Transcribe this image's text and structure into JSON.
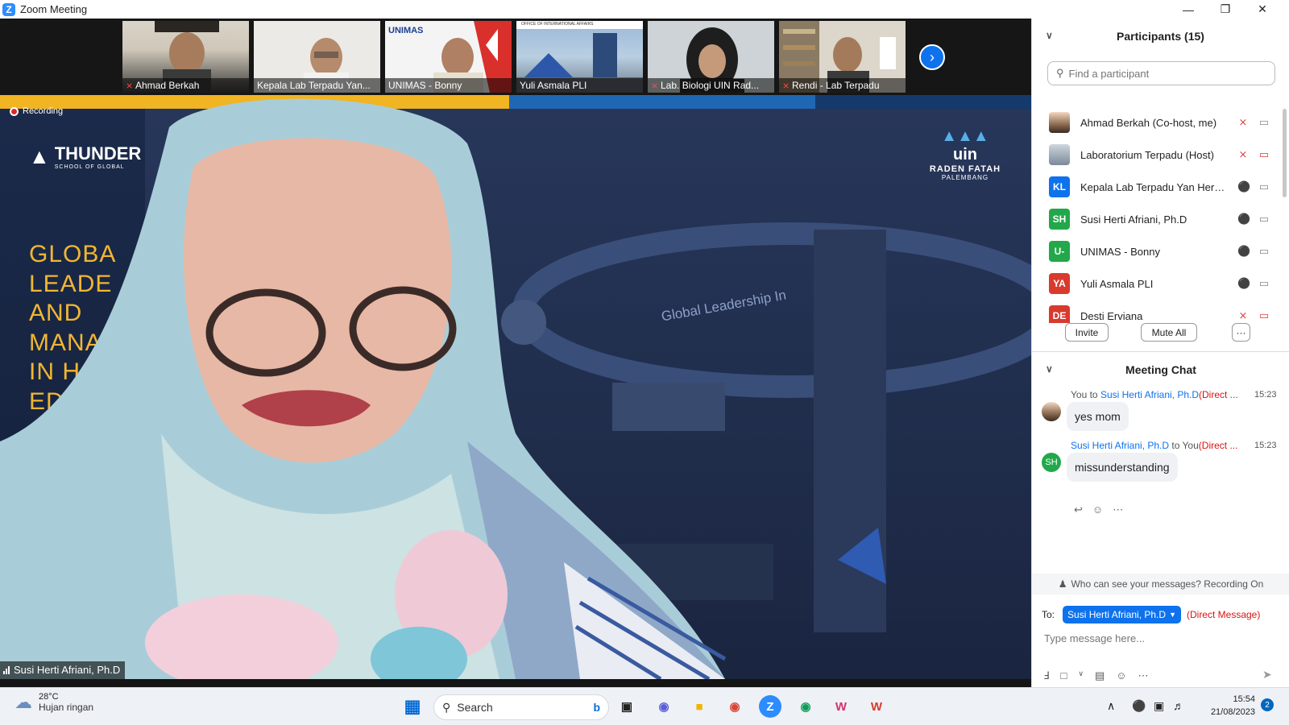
{
  "window": {
    "title": "Zoom Meeting"
  },
  "gallery": {
    "tiles": [
      {
        "name": "Ahmad Berkah",
        "muted": true
      },
      {
        "name": "Kepala Lab Terpadu Yan...",
        "muted": false
      },
      {
        "name": "UNIMAS - Bonny",
        "muted": false
      },
      {
        "name": "Yuli Asmala PLI",
        "muted": false
      },
      {
        "name": "Lab. Biologi UIN Rad...",
        "muted": true
      },
      {
        "name": "Rendi - Lab Terpadu",
        "muted": true
      }
    ],
    "tile_overlays": {
      "unimas_logo": "UNIMAS",
      "building_sign": "OFFICE OF INTERNATIONAL AFFAIRS"
    }
  },
  "speaker": {
    "recording_label": "Recording",
    "name": "Susi Herti Afriani, Ph.D",
    "slide_lines": [
      "GLOBA",
      "LEADE",
      "AND",
      "MANA",
      "IN H",
      "EDU"
    ],
    "slide_brand": "THUNDER",
    "slide_brand_sub": "SCHOOL OF GLOBAL",
    "background_wall_text": "Global Leadership In",
    "uin_logo": {
      "big": "uin",
      "mid": "RADEN FATAH",
      "small": "PALEMBANG"
    }
  },
  "participants": {
    "title": "Participants (15)",
    "search_placeholder": "Find a participant",
    "list": [
      {
        "name": "Ahmad Berkah (Co-host, me)",
        "initials": "",
        "color": "#8a6a50",
        "mic": "muted",
        "cam": "on"
      },
      {
        "name": "Laboratorium Terpadu (Host)",
        "initials": "",
        "color": "#7a8a9a",
        "mic": "muted",
        "cam": "off"
      },
      {
        "name": "Kepala Lab Terpadu Yan Hery ...",
        "initials": "KL",
        "color": "#0e72ed",
        "mic": "on",
        "cam": "on"
      },
      {
        "name": "Susi Herti Afriani, Ph.D",
        "initials": "SH",
        "color": "#22a84a",
        "mic": "on",
        "cam": "on"
      },
      {
        "name": "UNIMAS - Bonny",
        "initials": "U-",
        "color": "#22a84a",
        "mic": "on",
        "cam": "on"
      },
      {
        "name": "Yuli Asmala PLI",
        "initials": "YA",
        "color": "#d83a2e",
        "mic": "on",
        "cam": "on"
      },
      {
        "name": "Desti Erviana",
        "initials": "DE",
        "color": "#d83a2e",
        "mic": "muted",
        "cam": "off"
      }
    ],
    "buttons": {
      "invite": "Invite",
      "mute_all": "Mute All",
      "more": "···"
    }
  },
  "chat": {
    "title": "Meeting Chat",
    "messages": [
      {
        "from": "You",
        "to_word": "to",
        "to": "Susi Herti Afriani, Ph.D",
        "tag": "(Direct ...",
        "time": "15:23",
        "text": "yes mom"
      },
      {
        "from": "Susi Herti Afriani, Ph.D",
        "to_word": "to",
        "to": "You",
        "tag": "(Direct ...",
        "time": "15:23",
        "text": "missunderstanding"
      }
    ],
    "avatar_initials": "SH",
    "visibility": "Who can see your messages? Recording On",
    "to_label": "To:",
    "recipient": "Susi Herti Afriani, Ph.D",
    "direct_message": "(Direct Message)",
    "input_placeholder": "Type message here..."
  },
  "taskbar": {
    "weather_temp": "28°C",
    "weather_desc": "Hujan ringan",
    "search": "Search",
    "time": "15:54",
    "date": "21/08/2023",
    "notifications": "2"
  }
}
